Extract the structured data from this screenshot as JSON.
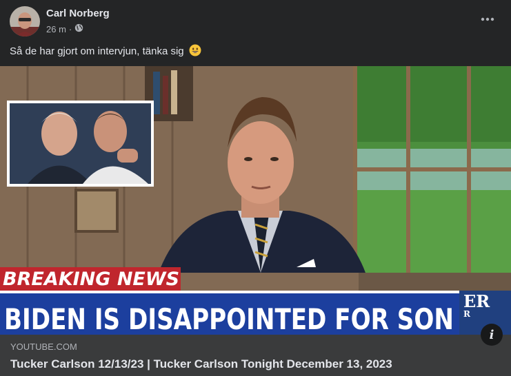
{
  "post": {
    "author": "Carl Norberg",
    "time": "26 m",
    "separator": "·",
    "privacy_icon": "globe-icon",
    "more_icon": "more-horizontal-icon",
    "text": "Så de har gjort om intervjun, tänka sig",
    "emoji": "grinning-face-emoji"
  },
  "media": {
    "banner_small": "BREAKING NEWS",
    "banner_large": "BIDEN IS DISAPPOINTED FOR SON",
    "corner_text": "ER",
    "corner_sub": "R",
    "info_label": "i"
  },
  "link": {
    "domain": "YOUTUBE.COM",
    "title": "Tucker Carlson 12/13/23 | Tucker Carlson Tonight December 13, 2023"
  },
  "colors": {
    "background": "#242526",
    "link_bar": "#3a3b3c",
    "banner_red": "#c0262d",
    "banner_blue": "#1c3f9e"
  }
}
